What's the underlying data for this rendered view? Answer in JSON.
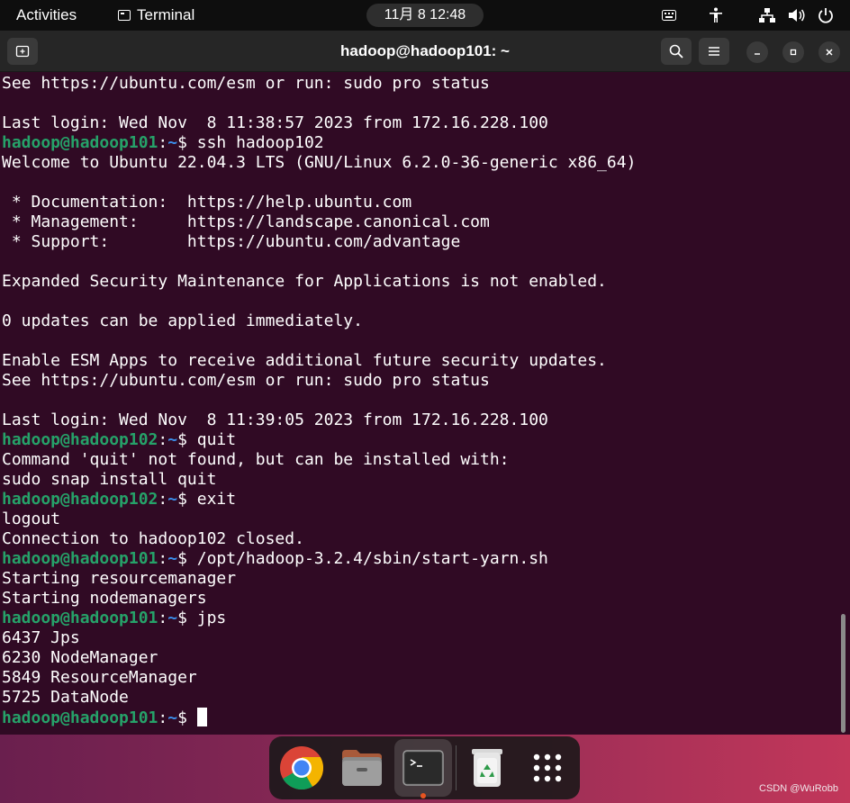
{
  "topbar": {
    "activities": "Activities",
    "app_menu": "Terminal",
    "clock": "11月 8  12:48"
  },
  "window": {
    "title": "hadoop@hadoop101: ~"
  },
  "terminal": {
    "lines": [
      [
        {
          "t": "See https://ubuntu.com/esm or run: sudo pro status"
        }
      ],
      [],
      [
        {
          "t": "Last login: Wed Nov  8 11:38:57 2023 from 172.16.228.100"
        }
      ],
      [
        {
          "t": "hadoop@hadoop101",
          "c": "u"
        },
        {
          "t": ":"
        },
        {
          "t": "~",
          "c": "p"
        },
        {
          "t": "$ ssh hadoop102"
        }
      ],
      [
        {
          "t": "Welcome to Ubuntu 22.04.3 LTS (GNU/Linux 6.2.0-36-generic x86_64)"
        }
      ],
      [],
      [
        {
          "t": " * Documentation:  https://help.ubuntu.com"
        }
      ],
      [
        {
          "t": " * Management:     https://landscape.canonical.com"
        }
      ],
      [
        {
          "t": " * Support:        https://ubuntu.com/advantage"
        }
      ],
      [],
      [
        {
          "t": "Expanded Security Maintenance for Applications is not enabled."
        }
      ],
      [],
      [
        {
          "t": "0 updates can be applied immediately."
        }
      ],
      [],
      [
        {
          "t": "Enable ESM Apps to receive additional future security updates."
        }
      ],
      [
        {
          "t": "See https://ubuntu.com/esm or run: sudo pro status"
        }
      ],
      [],
      [
        {
          "t": "Last login: Wed Nov  8 11:39:05 2023 from 172.16.228.100"
        }
      ],
      [
        {
          "t": "hadoop@hadoop102",
          "c": "u"
        },
        {
          "t": ":"
        },
        {
          "t": "~",
          "c": "p"
        },
        {
          "t": "$ quit"
        }
      ],
      [
        {
          "t": "Command 'quit' not found, but can be installed with:"
        }
      ],
      [
        {
          "t": "sudo snap install quit"
        }
      ],
      [
        {
          "t": "hadoop@hadoop102",
          "c": "u"
        },
        {
          "t": ":"
        },
        {
          "t": "~",
          "c": "p"
        },
        {
          "t": "$ exit"
        }
      ],
      [
        {
          "t": "logout"
        }
      ],
      [
        {
          "t": "Connection to hadoop102 closed."
        }
      ],
      [
        {
          "t": "hadoop@hadoop101",
          "c": "u"
        },
        {
          "t": ":"
        },
        {
          "t": "~",
          "c": "p"
        },
        {
          "t": "$ /opt/hadoop-3.2.4/sbin/start-yarn.sh"
        }
      ],
      [
        {
          "t": "Starting resourcemanager"
        }
      ],
      [
        {
          "t": "Starting nodemanagers"
        }
      ],
      [
        {
          "t": "hadoop@hadoop101",
          "c": "u"
        },
        {
          "t": ":"
        },
        {
          "t": "~",
          "c": "p"
        },
        {
          "t": "$ jps"
        }
      ],
      [
        {
          "t": "6437 Jps"
        }
      ],
      [
        {
          "t": "6230 NodeManager"
        }
      ],
      [
        {
          "t": "5849 ResourceManager"
        }
      ],
      [
        {
          "t": "5725 DataNode"
        }
      ],
      [
        {
          "t": "hadoop@hadoop101",
          "c": "u"
        },
        {
          "t": ":"
        },
        {
          "t": "~",
          "c": "p"
        },
        {
          "t": "$ "
        },
        {
          "cursor": true
        }
      ]
    ]
  },
  "dock": {
    "items": [
      {
        "name": "chrome-icon"
      },
      {
        "name": "files-icon"
      },
      {
        "name": "terminal-icon",
        "active": true
      },
      {
        "name": "trash-icon"
      },
      {
        "name": "app-grid-icon"
      }
    ]
  },
  "watermark": "CSDN @WuRobb",
  "colors": {
    "terminal_bg": "#300a24",
    "prompt_user": "#26a269",
    "prompt_path": "#3b8eea",
    "running_indicator": "#e95420"
  }
}
